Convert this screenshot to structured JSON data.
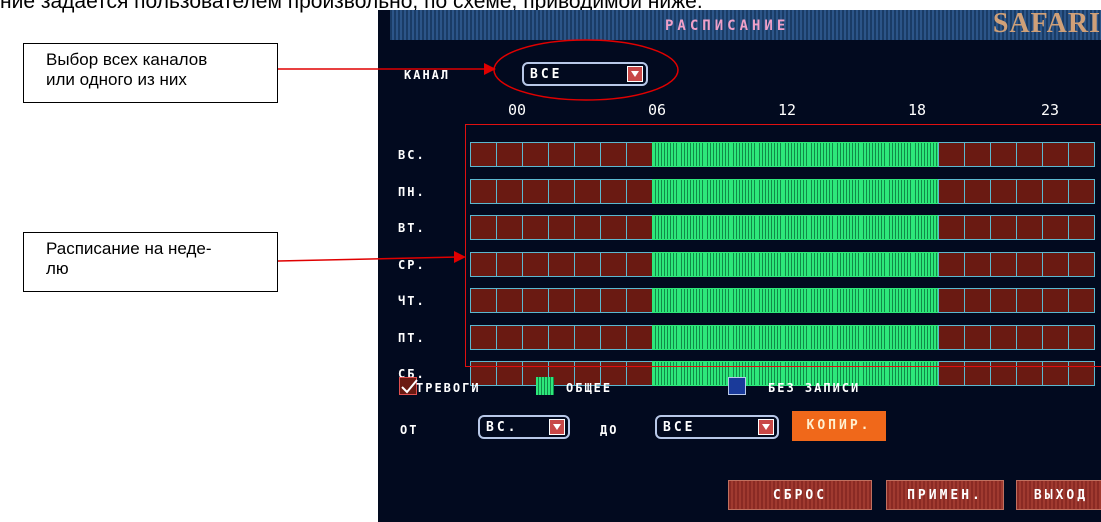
{
  "doc": {
    "top_line": "ние задается пользователем произвольно, по схеме, приводимой ниже.",
    "callouts": [
      {
        "lines": [
          "Выбор всех каналов",
          "или одного из них"
        ]
      },
      {
        "lines": [
          "Расписание на неде-",
          "лю"
        ]
      }
    ]
  },
  "dvr": {
    "title": "РАСПИСАНИЕ",
    "brand": "SAFARI",
    "channel_label": "КАНАЛ",
    "channel_value": "ВСЕ",
    "hours": [
      "00",
      "06",
      "12",
      "18",
      "23"
    ],
    "days": [
      "ВС.",
      "ПН.",
      "ВТ.",
      "СР.",
      "ЧТ.",
      "ПТ.",
      "СБ."
    ],
    "schedule": {
      "slots_per_day": 24,
      "normal_from_hour": 7,
      "normal_to_hour": 17,
      "note": "red = alarm recording, green = normal recording, same for all days"
    },
    "legend": {
      "alarm": "ТРЕВОГИ",
      "normal": "ОБЩЕЕ",
      "none": "БЕЗ ЗАПИСИ"
    },
    "copy_row": {
      "from_label": "ОТ",
      "from_value": "ВС.",
      "to_label": "ДО",
      "to_value": "ВСЕ",
      "copy_button": "КОПИР."
    },
    "buttons": {
      "reset": "СБРОС",
      "apply": "ПРИМЕН.",
      "exit": "ВЫХОД"
    },
    "colors": {
      "alarm": "#6a1a12",
      "normal": "#2de87a",
      "none": "#1a3a9a",
      "accent": "#f0681a"
    }
  }
}
